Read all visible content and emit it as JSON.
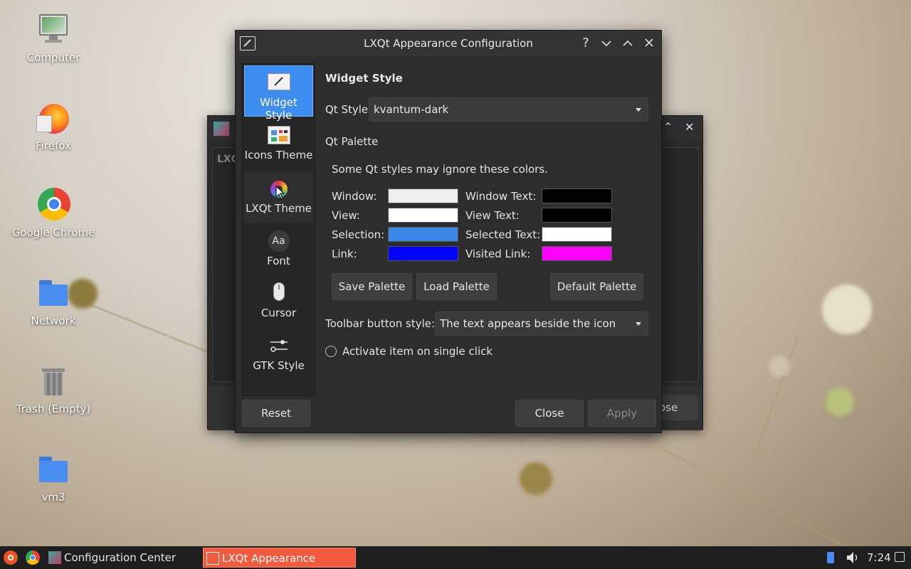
{
  "desktop": {
    "icons": [
      {
        "label": "Computer",
        "icon": "computer-icon"
      },
      {
        "label": "Firefox",
        "icon": "firefox-icon"
      },
      {
        "label": "Google Chrome",
        "icon": "chrome-icon"
      },
      {
        "label": "Network",
        "icon": "network-folder-icon"
      },
      {
        "label": "Trash (Empty)",
        "icon": "trash-icon"
      },
      {
        "label": "vm3",
        "icon": "home-folder-icon"
      }
    ]
  },
  "background_window": {
    "partial_title": "LXQ",
    "partial_button": "ose"
  },
  "dialog": {
    "title": "LXQt Appearance Configuration",
    "titlebar_buttons": [
      "?",
      "⌄",
      "⌃",
      "✕"
    ],
    "sidebar": [
      {
        "label": "Widget Style",
        "icon": "widget-style-icon",
        "selected": true
      },
      {
        "label": "Icons Theme",
        "icon": "icons-theme-icon",
        "selected": false
      },
      {
        "label": "LXQt Theme",
        "icon": "lxqt-theme-icon",
        "selected": false
      },
      {
        "label": "Font",
        "icon": "font-icon",
        "selected": false
      },
      {
        "label": "Cursor",
        "icon": "cursor-icon",
        "selected": false
      },
      {
        "label": "GTK Style",
        "icon": "gtk-style-icon",
        "selected": false
      }
    ],
    "section_title": "Widget Style",
    "qt_style": {
      "label": "Qt Style",
      "value": "kvantum-dark"
    },
    "qt_palette": {
      "label": "Qt Palette",
      "note": "Some Qt styles may ignore these colors.",
      "colors": {
        "window": {
          "label": "Window:",
          "color": "#efefef"
        },
        "window_text": {
          "label": "Window Text:",
          "color": "#000000"
        },
        "view": {
          "label": "View:",
          "color": "#ffffff"
        },
        "view_text": {
          "label": "View Text:",
          "color": "#000000"
        },
        "selection": {
          "label": "Selection:",
          "color": "#3c8ae8"
        },
        "selected_text": {
          "label": "Selected Text:",
          "color": "#ffffff"
        },
        "link": {
          "label": "Link:",
          "color": "#0000ff"
        },
        "visited_link": {
          "label": "Visited Link:",
          "color": "#ff00ff"
        }
      },
      "buttons": {
        "save": "Save Palette",
        "load": "Load Palette",
        "default": "Default Palette"
      }
    },
    "toolbar_style": {
      "label": "Toolbar button style:",
      "value": "The text appears beside the icon"
    },
    "single_click": {
      "label": "Activate item on single click",
      "checked": false
    },
    "footer": {
      "reset": "Reset",
      "close": "Close",
      "apply": "Apply"
    }
  },
  "taskbar": {
    "tasks": [
      {
        "label": "Configuration Center",
        "active": false
      },
      {
        "label": "LXQt Appearance Config...",
        "active": true
      }
    ],
    "clock": "7:24"
  },
  "colors": {
    "accent": "#3d8df0",
    "active_task": "#f15a3c"
  }
}
